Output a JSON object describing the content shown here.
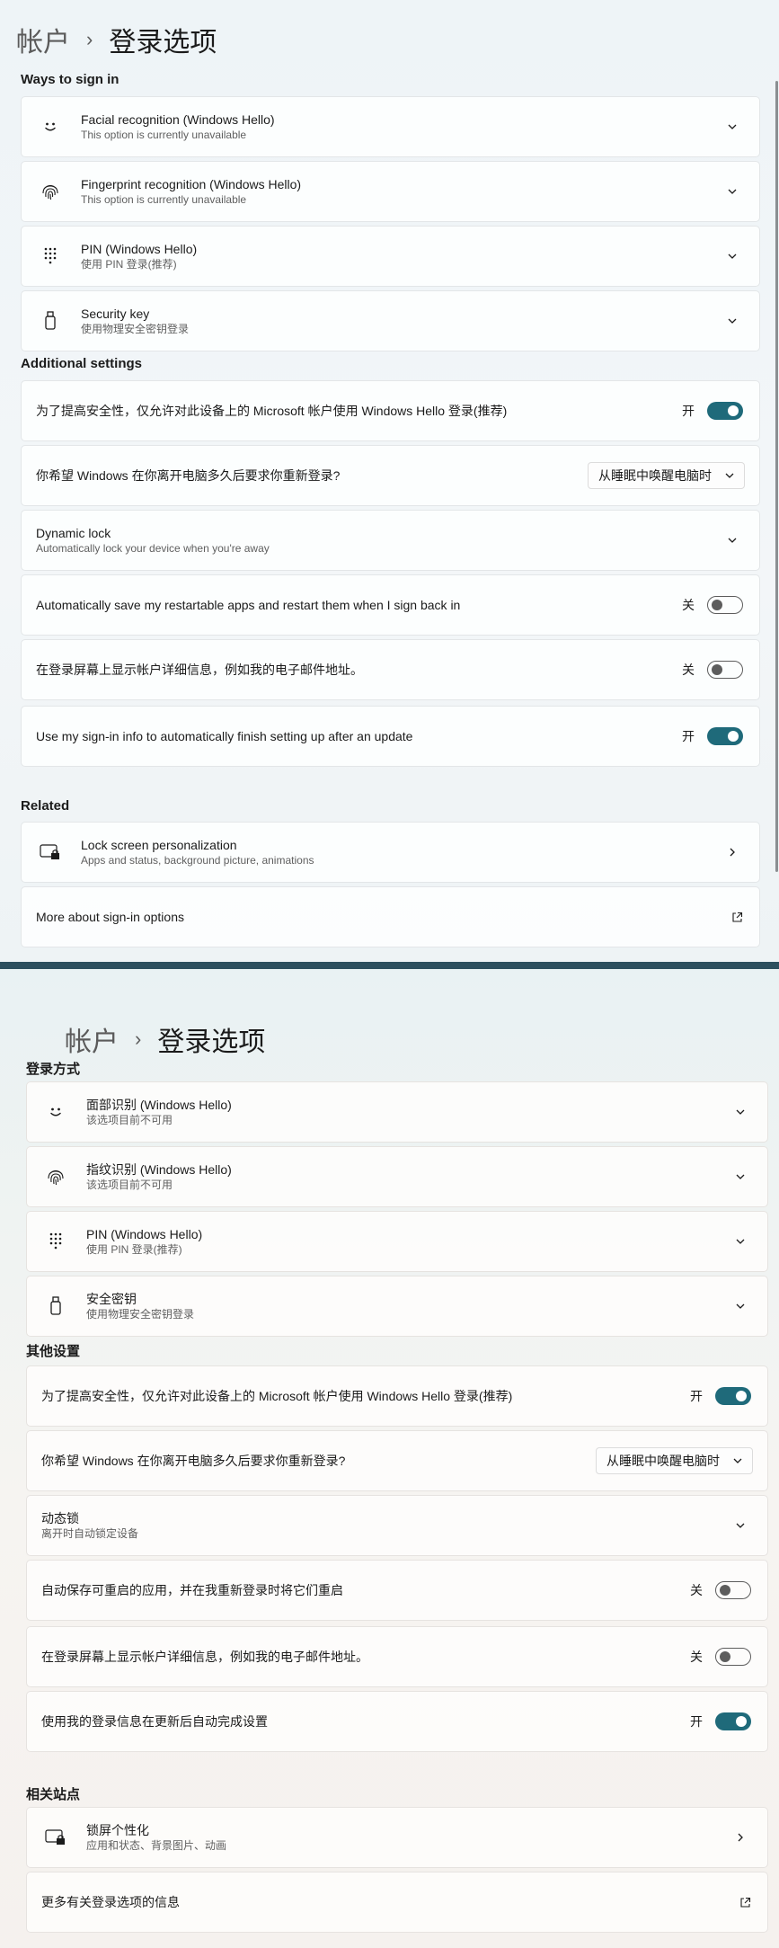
{
  "top": {
    "breadcrumb": {
      "parent": "帐户",
      "separator": "›",
      "current": "登录选项"
    },
    "sections": {
      "ways": "Ways to sign in",
      "additional": "Additional settings",
      "related": "Related"
    },
    "ways": [
      {
        "title": "Facial recognition (Windows Hello)",
        "subtitle": "This option is currently unavailable",
        "icon": "smile-face-icon"
      },
      {
        "title": "Fingerprint recognition (Windows Hello)",
        "subtitle": "This option is currently unavailable",
        "icon": "fingerprint-icon"
      },
      {
        "title": "PIN (Windows Hello)",
        "subtitle": "使用 PIN 登录(推荐)",
        "icon": "pin-keypad-icon"
      },
      {
        "title": "Security key",
        "subtitle": "使用物理安全密钥登录",
        "icon": "usb-key-icon"
      }
    ],
    "additional": {
      "hello_only": {
        "title": "为了提高安全性，仅允许对此设备上的 Microsoft 帐户使用 Windows Hello 登录(推荐)",
        "state": "开"
      },
      "relogin": {
        "title": "你希望 Windows 在你离开电脑多久后要求你重新登录?",
        "value": "从睡眠中唤醒电脑时"
      },
      "dynamic_lock": {
        "title": "Dynamic lock",
        "subtitle": "Automatically lock your device when you're away"
      },
      "restart_apps": {
        "title": "Automatically save my restartable apps and restart them when I sign back in",
        "state": "关"
      },
      "account_details": {
        "title": "在登录屏幕上显示帐户详细信息，例如我的电子邮件地址。",
        "state": "关"
      },
      "signin_info": {
        "title": "Use my sign-in info to automatically finish setting up after an update",
        "state": "开"
      }
    },
    "related": {
      "lock_screen": {
        "title": "Lock screen personalization",
        "subtitle": "Apps and status, background picture, animations"
      },
      "more": {
        "title": "More about sign-in options"
      }
    }
  },
  "bottom": {
    "breadcrumb": {
      "parent": "帐户",
      "separator": "›",
      "current": "登录选项"
    },
    "sections": {
      "ways": "登录方式",
      "additional": "其他设置",
      "related": "相关站点"
    },
    "ways": [
      {
        "title": "面部识别 (Windows Hello)",
        "subtitle": "该选项目前不可用",
        "icon": "smile-face-icon"
      },
      {
        "title": "指纹识别 (Windows Hello)",
        "subtitle": "该选项目前不可用",
        "icon": "fingerprint-icon"
      },
      {
        "title": "PIN (Windows Hello)",
        "subtitle": "使用 PIN 登录(推荐)",
        "icon": "pin-keypad-icon"
      },
      {
        "title": "安全密钥",
        "subtitle": "使用物理安全密钥登录",
        "icon": "usb-key-icon"
      }
    ],
    "additional": {
      "hello_only": {
        "title": "为了提高安全性，仅允许对此设备上的 Microsoft 帐户使用 Windows Hello 登录(推荐)",
        "state": "开"
      },
      "relogin": {
        "title": "你希望 Windows 在你离开电脑多久后要求你重新登录?",
        "value": "从睡眠中唤醒电脑时"
      },
      "dynamic_lock": {
        "title": "动态锁",
        "subtitle": "离开时自动锁定设备"
      },
      "restart_apps": {
        "title": "自动保存可重启的应用，并在我重新登录时将它们重启",
        "state": "关"
      },
      "account_details": {
        "title": "在登录屏幕上显示帐户详细信息，例如我的电子邮件地址。",
        "state": "关"
      },
      "signin_info": {
        "title": "使用我的登录信息在更新后自动完成设置",
        "state": "开"
      }
    },
    "related": {
      "lock_screen": {
        "title": "锁屏个性化",
        "subtitle": "应用和状态、背景图片、动画"
      },
      "more": {
        "title": "更多有关登录选项的信息"
      }
    }
  },
  "colors": {
    "toggle_on": "#1f6a7a",
    "divider": "#2c4f5e"
  }
}
